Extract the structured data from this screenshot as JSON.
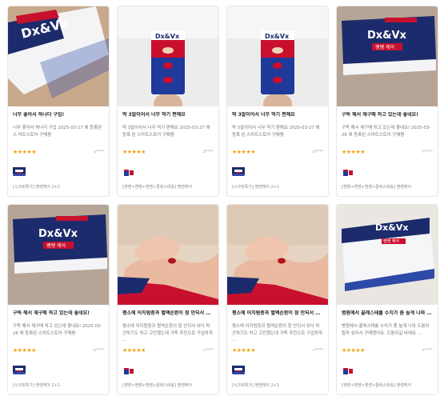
{
  "brand_colors": {
    "navy": "#1c2b6b",
    "red": "#c8102e",
    "star": "#f3a10f"
  },
  "reviews": [
    {
      "title": "너무 좋아서 하나더 구입!",
      "text": "너무 좋아서 하나더 구입 2025-03-27 에 등록된 스 마트스토어 구매평",
      "stars": "★★★★★",
      "user": "u****",
      "product": "[시크릿특가] 쌩쌩케어 2+1",
      "photo": "box-closeup",
      "thumb": "thumb-box"
    },
    {
      "title": "딱 3알이어서 너무 먹기 편해요",
      "text": "딱 3알이어서 너무 먹기 편해요 2025-03-27 에 등록 된 스마트스토어 구매평",
      "stars": "★★★★★",
      "user": "d****",
      "product": "[쌩쌩+쌩쌩+쌩쌩+콜레스테롤] 쌩쌩케어",
      "photo": "blister-hand",
      "thumb": "thumb-blister"
    },
    {
      "title": "딱 3알이어서 너무 먹기 편해요",
      "text": "딱 3알이어서 너무 먹기 편해요 2025-03-27 에 등록 된 스마트스토어 구매평",
      "stars": "★★★★★",
      "user": "d****",
      "product": "[시크릿특가] 쌩쌩케어 2+1",
      "photo": "blister-hand",
      "thumb": "thumb-box"
    },
    {
      "title": "구독 해서 재구매 하고 있는데 좋네요!",
      "text": "구독 해서 재구매 하고 있는데 좋네요! 2025-03-26 에 등록된 스마트스토어 구매평",
      "stars": "★★★★★",
      "user": "h****",
      "product": "[쌩쌩+쌩쌩+쌩쌩+콜레스테롤] 쌩쌩케어",
      "photo": "box-front",
      "thumb": "thumb-blister"
    },
    {
      "title": "구독 해서 재구매 하고 있는데 좋네요!",
      "text": "구독 해서 재구매 하고 있는데 좋네요! 2025-03-26 에 등록된 스마트스토어 구매평",
      "stars": "★★★★★",
      "user": "h****",
      "product": "[시크릿특가] 쌩쌩케어 2+1",
      "photo": "box-front",
      "thumb": "thumb-box"
    },
    {
      "title": "평소에 어지럼증과 혈액순환이 참 안되서 워낙 ...",
      "text": "평소에 어지럼증과 혈액순환이 참 안되서 워낙 피곤하기도 하고 고민했는데 가족 추천으로 구입하게 ...",
      "stars": "★★★★★",
      "user": "c****",
      "product": "[쌩쌩+쌩쌩+쌩쌩+콜레스테롤] 쌩쌩케어",
      "photo": "pill-hand",
      "thumb": "thumb-blister"
    },
    {
      "title": "평소에 어지럼증과 혈액순환이 참 안되서 워낙 ...",
      "text": "평소에 어지럼증과 혈액순환이 참 안되서 워낙 피곤하기도 하고 고민했는데 가족 추천으로 구입하게 ...",
      "stars": "★★★★★",
      "user": "c****",
      "product": "[시크릿특가] 쌩쌩케어 2+1",
      "photo": "pill-hand",
      "thumb": "thumb-box"
    },
    {
      "title": "병원에서 콜레스테롤 수치가 좀 높게 나와 도움...",
      "text": "병원에서 콜레스테롤 수치가 좀 높게 나와 도움이 될까 싶어서 구매했어요. 도움되길 바래요 ...",
      "stars": "★★★★★",
      "user": "k****",
      "product": "[쌩쌩+쌩쌩+쌩쌩+콜레스테롤] 쌩쌩케어",
      "photo": "box-side",
      "thumb": "thumb-blister"
    }
  ]
}
